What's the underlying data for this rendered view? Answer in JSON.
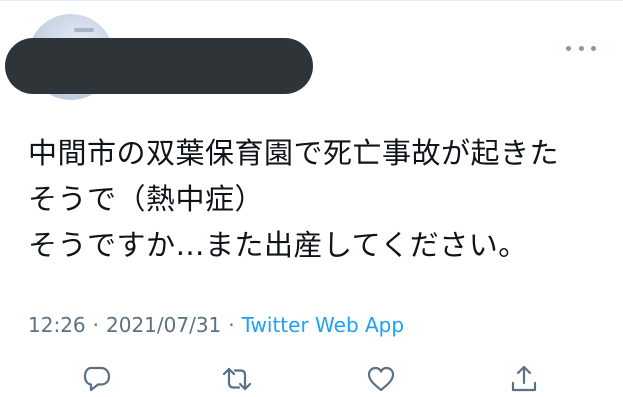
{
  "tweet": {
    "author": {
      "avatar_icon": "user-avatar",
      "name_redacted": true
    },
    "more_icon": "more-horizontal-icon",
    "text_lines": [
      "中間市の双葉保育園で死亡事故が起きた",
      "そうで（熱中症）",
      "そうですか…また出産してください。"
    ],
    "time": "12:26",
    "date": "2021/07/31",
    "separator": "·",
    "source": "Twitter Web App",
    "actions": {
      "reply_icon": "reply-icon",
      "retweet_icon": "retweet-icon",
      "like_icon": "heart-icon",
      "share_icon": "share-icon"
    }
  },
  "colors": {
    "text": "#0f1419",
    "muted": "#5b7083",
    "link": "#1da1f2",
    "icon": "#8899a6",
    "redaction": "#2f3438"
  }
}
